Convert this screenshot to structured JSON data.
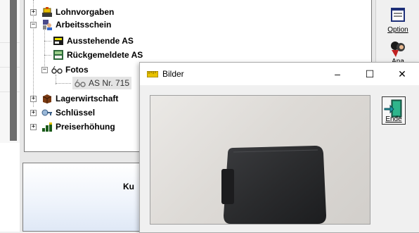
{
  "tree": {
    "items": [
      {
        "label": "Lohnvorgaben",
        "expander": "+"
      },
      {
        "label": "Arbeitsschein",
        "expander": "−"
      },
      {
        "label": "Ausstehende AS"
      },
      {
        "label": "Rückgemeldete AS"
      },
      {
        "label": "Fotos",
        "expander": "−"
      },
      {
        "label": "AS Nr. 715"
      },
      {
        "label": "Lagerwirtschaft",
        "expander": "+"
      },
      {
        "label": "Schlüssel",
        "expander": "+"
      },
      {
        "label": "Preiserhöhung",
        "expander": "+"
      }
    ]
  },
  "lower_panel": {
    "label": "Ku"
  },
  "toolbar": {
    "option_label": "Option",
    "ana_label": "Ana"
  },
  "dialog": {
    "title": "Bilder",
    "minimize": "–",
    "maximize": "☐",
    "close": "✕",
    "ende_label": "Ende"
  },
  "colors": {
    "photo_bg": "#dcdad6",
    "phone_case": "#2a2b2d",
    "tree_border": "#7a7a7a"
  }
}
